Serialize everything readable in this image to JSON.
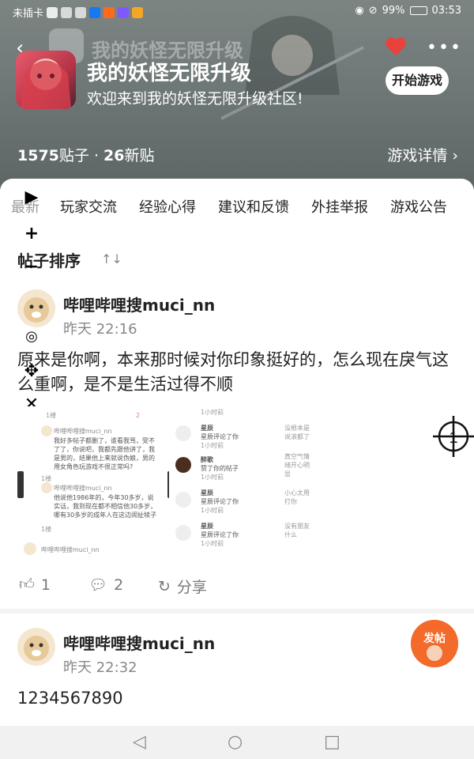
{
  "status_bar": {
    "carrier": "未插卡",
    "battery": "99%",
    "time": "03:53"
  },
  "header": {
    "ghost_title": "我的妖怪无限升级",
    "game_title": "我的妖怪无限升级",
    "welcome": "欢迎来到我的妖怪无限升级社区!",
    "play_button": "开始游戏",
    "post_count": "1575",
    "post_unit": "贴子",
    "separator": " · ",
    "new_count": "26",
    "new_unit": "新贴",
    "details": "游戏详情 ›",
    "heart_color": "#e8423b"
  },
  "tabs": [
    "最新",
    "玩家交流",
    "经验心得",
    "建议和反馈",
    "外挂举报",
    "游戏公告"
  ],
  "sort_label": "帖子排序",
  "sort_icon": "↑↓",
  "posts": [
    {
      "author": "哔哩哔哩搜muci_nn",
      "time": "昨天 22:16",
      "text": "原来是你啊，本来那时候对你印象挺好的，怎么现在戾气这么重啊，是不是生活过得不顺",
      "likes": "1",
      "comments": "2",
      "share": "分享",
      "image_a": {
        "header_left": "1楼",
        "header_right": "2",
        "c1_name": "哔哩哔哩搜muci_nn",
        "c1_text": "我好多帖子都删了，谁看我骂，受不了了，你说吧，我都先跟他讲了，我是男的，结果他上来就说伪娘，男的用女角色玩游戏不很正常吗?",
        "c1_floor": "1楼",
        "c2_name": "哔哩哔哩搜muci_nn",
        "c2_text": "他说他1986年的，今年30多岁，说实话，我到现在都不相信他30多岁，哪有30多岁的成年人在这边闹扯犊子",
        "c2_floor": "1楼",
        "footer_name": "哔哩哔哩搜muci_nn"
      },
      "image_b": {
        "rows": [
          {
            "name": "",
            "action": "",
            "time": "1小时前",
            "note": ""
          },
          {
            "name": "星辰",
            "action": "星辰评论了你",
            "time": "1小时前",
            "note": "没根本是说滚都了"
          },
          {
            "name": "醉歌",
            "action": "赞了你的帖子",
            "time": "1小时前",
            "note": ""
          },
          {
            "name": "星辰",
            "action": "星辰评论了你",
            "time": "1小时前",
            "note": "真空气情绪开心明显"
          },
          {
            "name": "星辰",
            "action": "星辰评论了你",
            "time": "1小时前",
            "note": "小心太用打你"
          },
          {
            "name": "星辰",
            "action": "星辰评论了你",
            "time": "1小时前",
            "note": "没有朋友什么"
          }
        ]
      }
    },
    {
      "author": "哔哩哔哩搜muci_nn",
      "time": "昨天 22:32",
      "text": "1234567890"
    }
  ],
  "crosshair_label": "1",
  "fab_label": "发帖",
  "nav": {
    "back": "◁",
    "home": "○",
    "recent": "□"
  },
  "colors": {
    "fab": "#f36a2b",
    "accent_red": "#e8423b"
  }
}
